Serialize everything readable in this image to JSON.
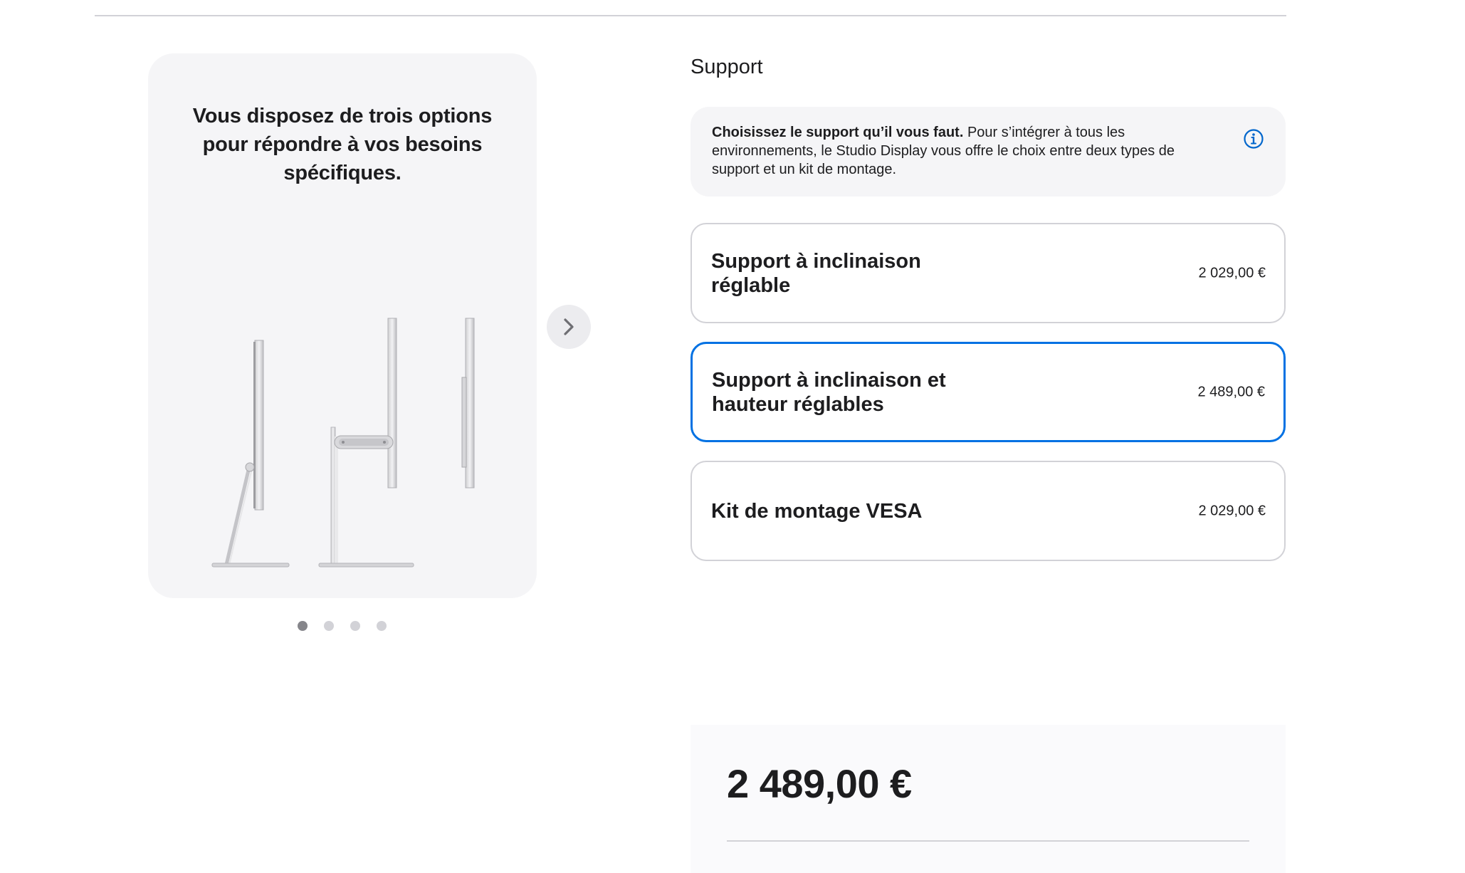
{
  "gallery": {
    "caption": "Vous disposez de trois options pour répondre à vos besoins spécifiques.",
    "next_icon": "chevron-right-icon",
    "dots_total": 4,
    "dots_active_index": 0
  },
  "support": {
    "title": "Support",
    "info": {
      "bold": "Choisissez le support qu’il vous faut.",
      "text": " Pour s’intégrer à tous les environnements, le Studio Display vous offre le choix entre deux types de support et un kit de montage.",
      "icon": "info-circle-icon"
    },
    "options": [
      {
        "label": "Support à inclinaison réglable",
        "price": "2 029,00 €",
        "selected": false
      },
      {
        "label": "Support à inclinaison et hauteur réglables",
        "price": "2 489,00 €",
        "selected": true
      },
      {
        "label": "Kit de montage VESA",
        "price": "2 029,00 €",
        "selected": false
      }
    ]
  },
  "summary": {
    "total": "2 489,00 €"
  },
  "colors": {
    "accent": "#0071e3",
    "text": "#1d1d1f",
    "card_bg": "#f5f5f7",
    "border": "#d2d2d7"
  }
}
